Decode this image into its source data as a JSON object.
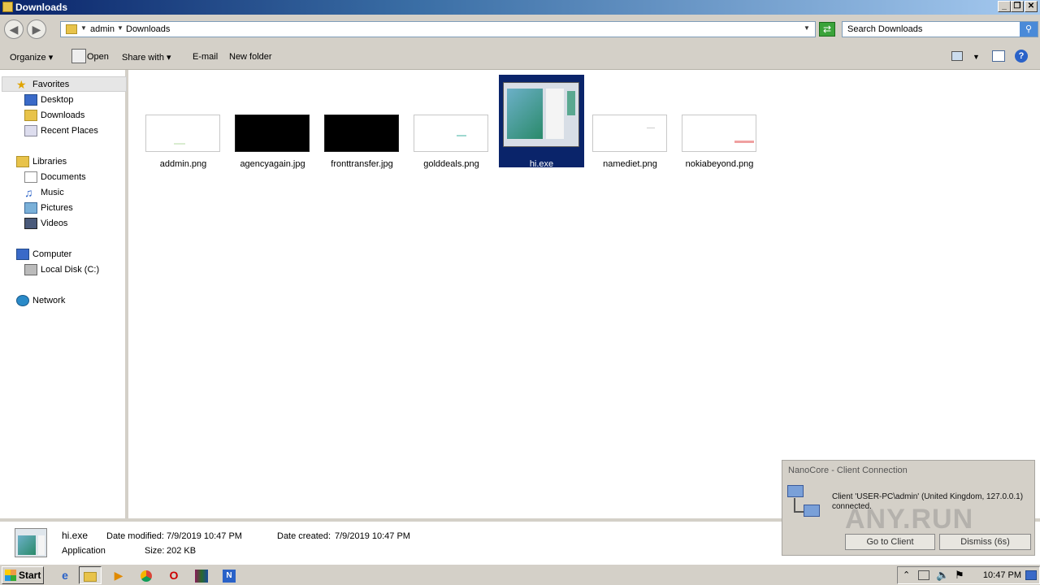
{
  "window": {
    "title": "Downloads"
  },
  "titlebar_buttons": {
    "minimize": "_",
    "restore": "❐",
    "close": "✕"
  },
  "address": {
    "crumbs": [
      "admin",
      "Downloads"
    ]
  },
  "search": {
    "placeholder": "Search Downloads"
  },
  "toolbar": {
    "organize": "Organize",
    "open": "Open",
    "share_with": "Share with",
    "email": "E-mail",
    "new_folder": "New folder"
  },
  "nav": {
    "favorites": {
      "label": "Favorites",
      "items": [
        "Desktop",
        "Downloads",
        "Recent Places"
      ]
    },
    "libraries": {
      "label": "Libraries",
      "items": [
        "Documents",
        "Music",
        "Pictures",
        "Videos"
      ]
    },
    "computer": {
      "label": "Computer",
      "items": [
        "Local Disk (C:)"
      ]
    },
    "network": {
      "label": "Network"
    }
  },
  "files": [
    {
      "name": "addmin.png",
      "thumb": "light"
    },
    {
      "name": "agencyagain.jpg",
      "thumb": "black"
    },
    {
      "name": "fronttransfer.jpg",
      "thumb": "black"
    },
    {
      "name": "golddeals.png",
      "thumb": "light"
    },
    {
      "name": "hi.exe",
      "thumb": "app",
      "selected": true
    },
    {
      "name": "namediet.png",
      "thumb": "light"
    },
    {
      "name": "nokiabeyond.png",
      "thumb": "light"
    }
  ],
  "details": {
    "name": "hi.exe",
    "type": "Application",
    "modified_label": "Date modified:",
    "modified": "7/9/2019 10:47 PM",
    "created_label": "Date created:",
    "created": "7/9/2019 10:47 PM",
    "size_label": "Size:",
    "size": "202 KB"
  },
  "notification": {
    "title": "NanoCore - Client Connection",
    "message": "Client 'USER-PC\\admin' (United Kingdom, 127.0.0.1) connected.",
    "go_button": "Go to Client",
    "dismiss_button": "Dismiss (6s)"
  },
  "watermark": "ANY.RUN",
  "taskbar": {
    "start": "Start",
    "clock": "10:47 PM"
  },
  "colors": {
    "selection": "#0a246a",
    "chrome": "#d4d0c8"
  }
}
